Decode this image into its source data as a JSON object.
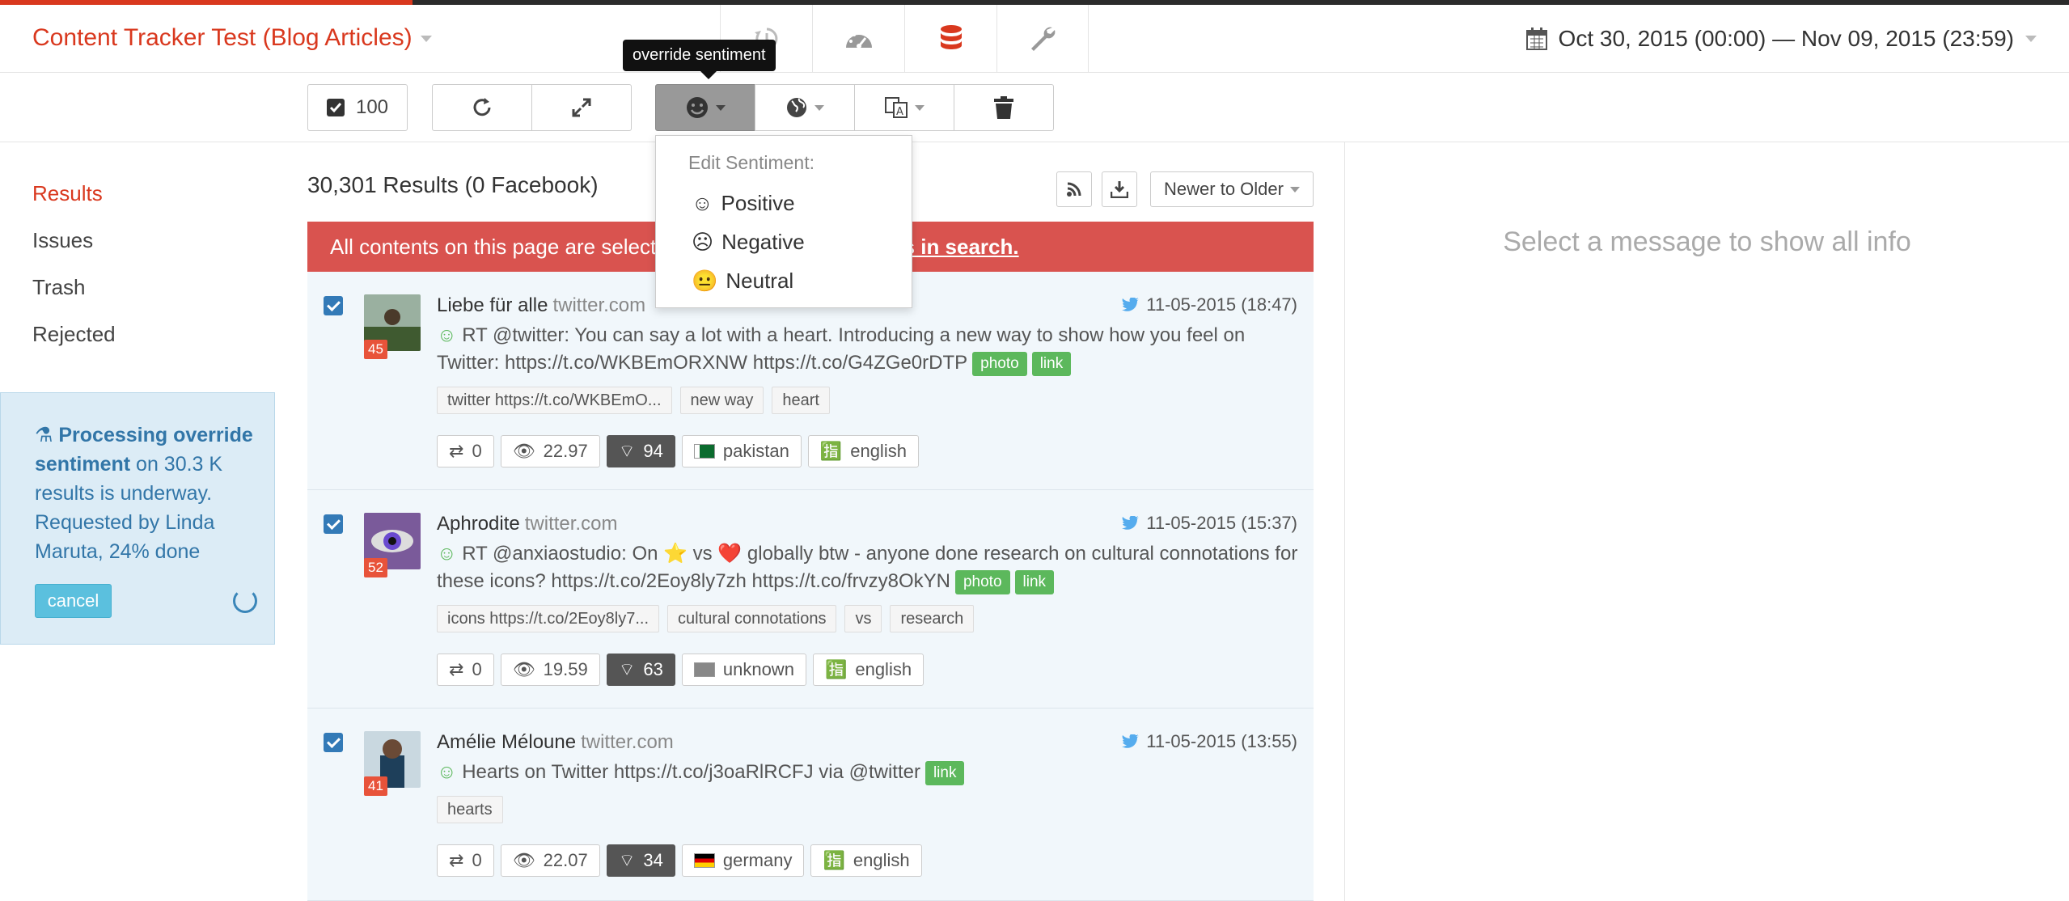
{
  "header": {
    "title": "Content Tracker Test (Blog Articles)",
    "date_range": "Oct 30, 2015 (00:00) — Nov 09, 2015 (23:59)",
    "icons": [
      "history-icon",
      "dashboard-icon",
      "database-icon",
      "wrench-icon"
    ]
  },
  "toolbar": {
    "select_count": "100",
    "tooltip": "override sentiment"
  },
  "sentiment_menu": {
    "heading": "Edit Sentiment:",
    "options": [
      "Positive",
      "Negative",
      "Neutral"
    ]
  },
  "sidebar": {
    "items": [
      "Results",
      "Issues",
      "Trash",
      "Rejected"
    ],
    "active": "Results",
    "process": {
      "bold": "Processing override sentiment",
      "rest": " on 30.3 K results is underway. Requested by Linda Maruta, 24% done",
      "progress_percent": 24,
      "cancel_label": "cancel"
    }
  },
  "results": {
    "count": "30,301 Results (0 Facebook)",
    "sort": "Newer to Older",
    "alert_left": "All contents on this page are select",
    "alert_link": "nts in search."
  },
  "items": [
    {
      "author": "Liebe für alle",
      "source": "twitter.com",
      "time": "11-05-2015 (18:47)",
      "badge": "45",
      "message": "RT @twitter: You can say a lot with a heart. Introducing a new way to show how you feel on Twitter: https://t.co/WKBEmORXNW https://t.co/G4ZGe0rDTP",
      "labels": [
        "photo",
        "link"
      ],
      "tags": [
        "twitter https://t.co/WKBEmO...",
        "new way",
        "heart"
      ],
      "retweets": "0",
      "views": "22.97",
      "reach": "94",
      "country": "pakistan",
      "language": "english"
    },
    {
      "author": "Aphrodite",
      "source": "twitter.com",
      "time": "11-05-2015 (15:37)",
      "badge": "52",
      "message": "RT @anxiaostudio: On ⭐ vs ❤️ globally btw - anyone done research on cultural connotations for these icons? https://t.co/2Eoy8ly7zh https://t.co/frvzy8OkYN",
      "labels": [
        "photo",
        "link"
      ],
      "tags": [
        "icons https://t.co/2Eoy8ly7...",
        "cultural connotations",
        "vs",
        "research"
      ],
      "retweets": "0",
      "views": "19.59",
      "reach": "63",
      "country": "unknown",
      "language": "english"
    },
    {
      "author": "Amélie Méloune",
      "source": "twitter.com",
      "time": "11-05-2015 (13:55)",
      "badge": "41",
      "message": "Hearts on Twitter https://t.co/j3oaRlRCFJ via @twitter",
      "labels": [
        "link"
      ],
      "tags": [
        "hearts"
      ],
      "retweets": "0",
      "views": "22.07",
      "reach": "34",
      "country": "germany",
      "language": "english"
    }
  ],
  "right_pane": {
    "placeholder": "Select a message to show all info"
  }
}
